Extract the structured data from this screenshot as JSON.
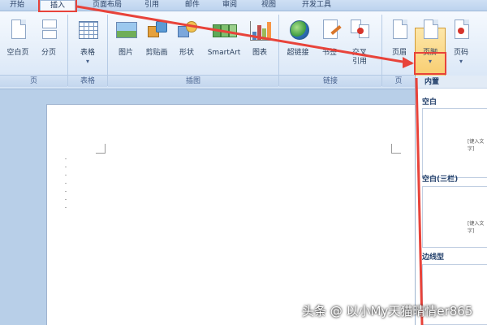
{
  "tabs": [
    {
      "label": "开始",
      "active": false
    },
    {
      "label": "插入",
      "active": true
    },
    {
      "label": "页面布局",
      "active": false
    },
    {
      "label": "引用",
      "active": false
    },
    {
      "label": "邮件",
      "active": false
    },
    {
      "label": "审阅",
      "active": false
    },
    {
      "label": "视图",
      "active": false
    },
    {
      "label": "开发工具",
      "active": false
    }
  ],
  "ribbon": {
    "buttons": [
      {
        "label": "空白页",
        "icon": "blank-page-icon"
      },
      {
        "label": "分页",
        "icon": "page-break-icon"
      },
      {
        "label": "表格",
        "icon": "table-icon",
        "dropdown": "▾"
      },
      {
        "label": "图片",
        "icon": "picture-icon"
      },
      {
        "label": "剪贴画",
        "icon": "clip-art-icon"
      },
      {
        "label": "形状",
        "icon": "shapes-icon"
      },
      {
        "label": "SmartArt",
        "icon": "smartart-icon"
      },
      {
        "label": "图表",
        "icon": "chart-icon"
      },
      {
        "label": "超链接",
        "icon": "hyperlink-icon"
      },
      {
        "label": "书签",
        "icon": "bookmark-icon"
      },
      {
        "label": "交叉",
        "label2": "引用",
        "icon": "cross-reference-icon"
      },
      {
        "label": "页眉",
        "icon": "header-icon"
      },
      {
        "label": "页脚",
        "icon": "footer-icon",
        "dropdown": "▾"
      },
      {
        "label": "页码",
        "icon": "page-number-icon",
        "dropdown": "▾"
      }
    ],
    "groups": [
      "页",
      "表格",
      "插图",
      "链接",
      "页"
    ]
  },
  "gallery": {
    "header": "内置",
    "items": [
      "空白",
      "空白(三栏)",
      "边线型"
    ],
    "thumb_mark": "[键入文字]"
  },
  "colors": {
    "highlight": "#f7c865",
    "annotation_red": "#e8433a",
    "ribbon": "#e3edf9"
  },
  "watermark": "头条 @ 以小My天猫晴情er865"
}
